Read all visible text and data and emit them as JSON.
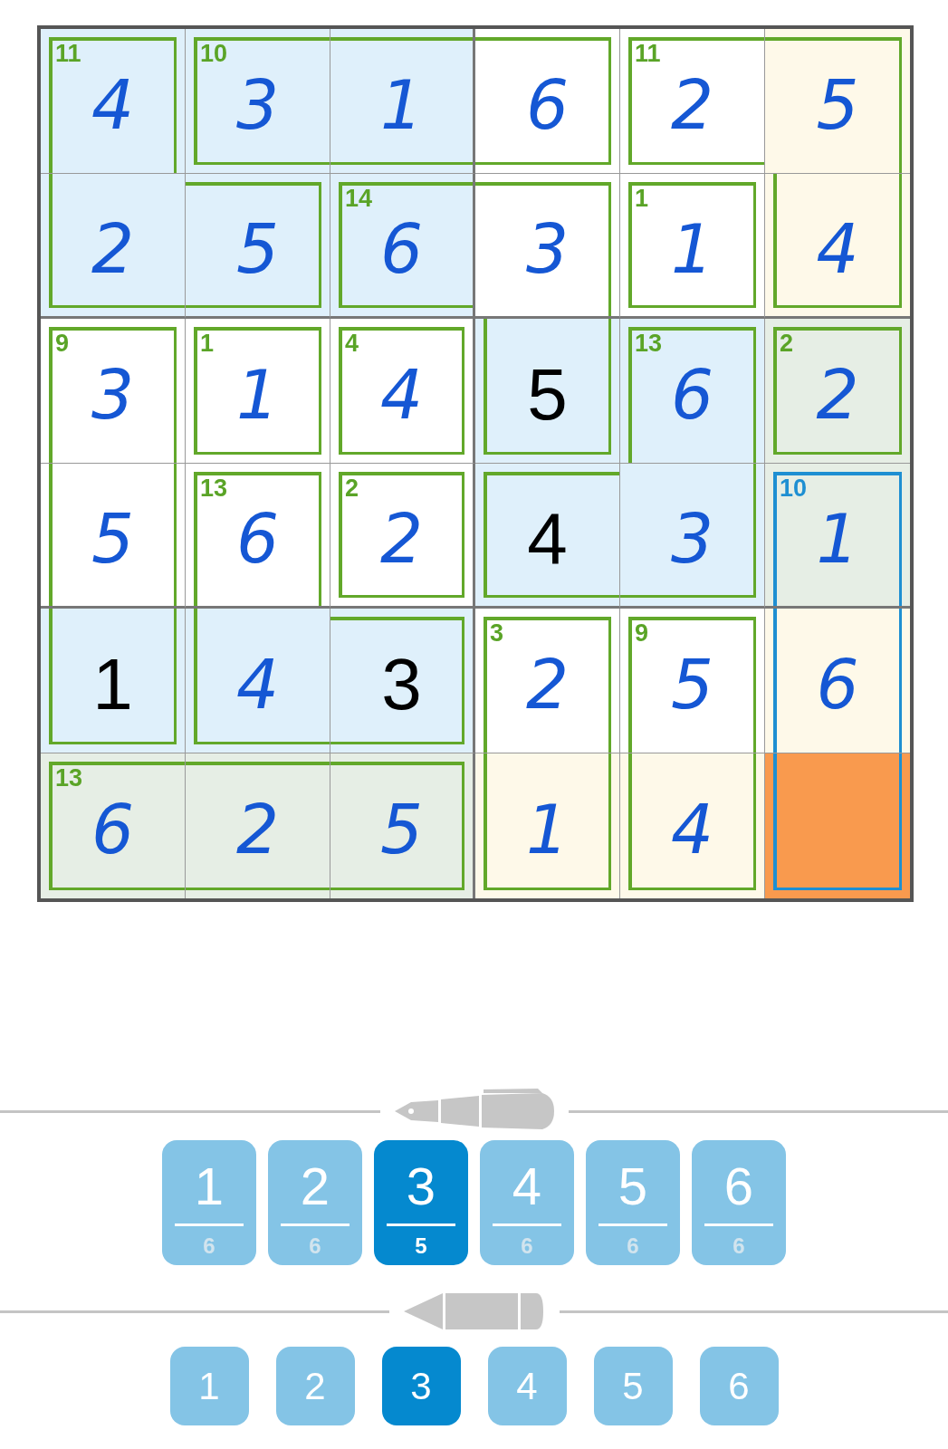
{
  "grid": {
    "rows": [
      [
        {
          "value": "4",
          "given": false,
          "color": "#dff0fb",
          "sum": "11",
          "top": true,
          "right": true,
          "bottom": false,
          "left": true,
          "cage_selected": false
        },
        {
          "value": "3",
          "given": false,
          "color": "#dff0fb",
          "sum": "10",
          "top": true,
          "right": false,
          "bottom": true,
          "left": true,
          "cage_selected": false
        },
        {
          "value": "1",
          "given": false,
          "color": "#dff0fb",
          "top": true,
          "right": false,
          "bottom": true,
          "left": false,
          "cage_selected": false
        },
        {
          "value": "6",
          "given": false,
          "color": "#ffffff",
          "top": true,
          "right": true,
          "bottom": true,
          "left": false,
          "cage_selected": false
        },
        {
          "value": "2",
          "given": false,
          "color": "#ffffff",
          "sum": "11",
          "top": true,
          "right": false,
          "bottom": true,
          "left": true,
          "cage_selected": false
        },
        {
          "value": "5",
          "given": false,
          "color": "#fef9e9",
          "top": true,
          "right": true,
          "bottom": false,
          "left": false,
          "cage_selected": false
        }
      ],
      [
        {
          "value": "2",
          "given": false,
          "color": "#dff0fb",
          "top": false,
          "right": false,
          "bottom": true,
          "left": true,
          "cage_selected": false
        },
        {
          "value": "5",
          "given": false,
          "color": "#dff0fb",
          "top": true,
          "right": true,
          "bottom": true,
          "left": false,
          "cage_selected": false
        },
        {
          "value": "6",
          "given": false,
          "color": "#dff0fb",
          "sum": "14",
          "top": true,
          "right": false,
          "bottom": true,
          "left": true,
          "cage_selected": false
        },
        {
          "value": "3",
          "given": false,
          "color": "#ffffff",
          "top": true,
          "right": true,
          "bottom": false,
          "left": false,
          "cage_selected": false
        },
        {
          "value": "1",
          "given": false,
          "color": "#ffffff",
          "sum": "1",
          "top": true,
          "right": true,
          "bottom": true,
          "left": true,
          "cage_selected": false
        },
        {
          "value": "4",
          "given": false,
          "color": "#fef9e9",
          "top": false,
          "right": true,
          "bottom": true,
          "left": true,
          "cage_selected": false
        }
      ],
      [
        {
          "value": "3",
          "given": false,
          "color": "#ffffff",
          "sum": "9",
          "top": true,
          "right": true,
          "bottom": false,
          "left": true,
          "cage_selected": false
        },
        {
          "value": "1",
          "given": false,
          "color": "#ffffff",
          "sum": "1",
          "top": true,
          "right": true,
          "bottom": true,
          "left": true,
          "cage_selected": false
        },
        {
          "value": "4",
          "given": false,
          "color": "#ffffff",
          "sum": "4",
          "top": true,
          "right": true,
          "bottom": true,
          "left": true,
          "cage_selected": false
        },
        {
          "value": "5",
          "given": true,
          "color": "#dff0fb",
          "top": false,
          "right": true,
          "bottom": true,
          "left": true,
          "cage_selected": false
        },
        {
          "value": "6",
          "given": false,
          "color": "#dff0fb",
          "sum": "13",
          "top": true,
          "right": true,
          "bottom": false,
          "left": true,
          "cage_selected": false
        },
        {
          "value": "2",
          "given": false,
          "color": "#e6eee5",
          "sum": "2",
          "top": true,
          "right": true,
          "bottom": true,
          "left": true,
          "cage_selected": false
        }
      ],
      [
        {
          "value": "5",
          "given": false,
          "color": "#ffffff",
          "top": false,
          "right": true,
          "bottom": false,
          "left": true,
          "cage_selected": false
        },
        {
          "value": "6",
          "given": false,
          "color": "#ffffff",
          "sum": "13",
          "top": true,
          "right": true,
          "bottom": false,
          "left": true,
          "cage_selected": false
        },
        {
          "value": "2",
          "given": false,
          "color": "#ffffff",
          "sum": "2",
          "top": true,
          "right": true,
          "bottom": true,
          "left": true,
          "cage_selected": false
        },
        {
          "value": "4",
          "given": true,
          "color": "#dff0fb",
          "top": true,
          "right": false,
          "bottom": true,
          "left": true,
          "cage_selected": false
        },
        {
          "value": "3",
          "given": false,
          "color": "#dff0fb",
          "top": false,
          "right": true,
          "bottom": true,
          "left": false,
          "cage_selected": false
        },
        {
          "value": "1",
          "given": false,
          "color": "#e6eee5",
          "sum": "10",
          "top": true,
          "right": true,
          "bottom": false,
          "left": true,
          "cage_selected": true
        }
      ],
      [
        {
          "value": "1",
          "given": true,
          "color": "#dff0fb",
          "top": false,
          "right": true,
          "bottom": true,
          "left": true,
          "cage_selected": false
        },
        {
          "value": "4",
          "given": false,
          "color": "#dff0fb",
          "top": false,
          "right": false,
          "bottom": true,
          "left": true,
          "cage_selected": false
        },
        {
          "value": "3",
          "given": true,
          "color": "#dff0fb",
          "top": true,
          "right": true,
          "bottom": true,
          "left": false,
          "cage_selected": false
        },
        {
          "value": "2",
          "given": false,
          "color": "#ffffff",
          "sum": "3",
          "top": true,
          "right": true,
          "bottom": false,
          "left": true,
          "cage_selected": false
        },
        {
          "value": "5",
          "given": false,
          "color": "#ffffff",
          "sum": "9",
          "top": true,
          "right": true,
          "bottom": false,
          "left": true,
          "cage_selected": false
        },
        {
          "value": "6",
          "given": false,
          "color": "#fef9e9",
          "top": false,
          "right": true,
          "bottom": false,
          "left": true,
          "cage_selected": true
        }
      ],
      [
        {
          "value": "6",
          "given": false,
          "color": "#e6eee5",
          "sum": "13",
          "top": true,
          "right": false,
          "bottom": true,
          "left": true,
          "cage_selected": false
        },
        {
          "value": "2",
          "given": false,
          "color": "#e6eee5",
          "top": true,
          "right": false,
          "bottom": true,
          "left": false,
          "cage_selected": false
        },
        {
          "value": "5",
          "given": false,
          "color": "#e6eee5",
          "top": true,
          "right": true,
          "bottom": true,
          "left": false,
          "cage_selected": false
        },
        {
          "value": "1",
          "given": false,
          "color": "#fef9e9",
          "top": false,
          "right": true,
          "bottom": true,
          "left": true,
          "cage_selected": false
        },
        {
          "value": "4",
          "given": false,
          "color": "#fef9e9",
          "top": false,
          "right": true,
          "bottom": true,
          "left": true,
          "cage_selected": false
        },
        {
          "color": "#f99a4e",
          "top": false,
          "right": true,
          "bottom": true,
          "left": true,
          "cage_selected": true
        }
      ]
    ]
  },
  "pen": {
    "buttons": [
      {
        "digit": "1",
        "count": "6",
        "selected": false
      },
      {
        "digit": "2",
        "count": "6",
        "selected": false
      },
      {
        "digit": "3",
        "count": "5",
        "selected": true
      },
      {
        "digit": "4",
        "count": "6",
        "selected": false
      },
      {
        "digit": "5",
        "count": "6",
        "selected": false
      },
      {
        "digit": "6",
        "count": "6",
        "selected": false
      }
    ]
  },
  "pencil": {
    "buttons": [
      {
        "digit": "1",
        "selected": false
      },
      {
        "digit": "2",
        "selected": false
      },
      {
        "digit": "3",
        "selected": true
      },
      {
        "digit": "4",
        "selected": false
      },
      {
        "digit": "5",
        "selected": false
      },
      {
        "digit": "6",
        "selected": false
      }
    ]
  }
}
